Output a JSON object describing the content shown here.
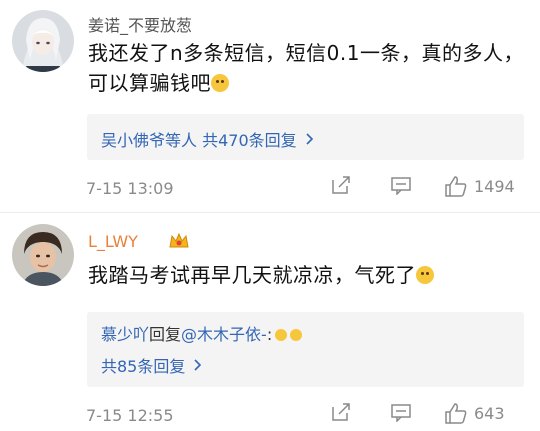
{
  "comments": [
    {
      "username": "姜诺_不要放葱",
      "text": "我还发了n多条短信，短信0.1一条，真的多人，可以算骗钱吧",
      "reply_summary": "吴小佛爷等人 共470条回复",
      "time": "7-15 13:09",
      "likes": "1494"
    },
    {
      "username": "L_LWY",
      "text": "我踏马考试再早几天就凉凉，气死了",
      "reply_user": "慕少吖",
      "reply_word": "回复",
      "reply_target": "@木木子依-",
      "reply_colon": ":",
      "reply_total": "共85条回复",
      "time": "7-15 12:55",
      "likes": "643"
    }
  ],
  "colors": {
    "link": "#3366b5",
    "vip_name": "#e8823a",
    "meta": "#8a8a8a"
  },
  "icons": [
    "repost-icon",
    "comment-icon",
    "like-icon",
    "chevron-right-icon",
    "vip-crown-icon"
  ]
}
